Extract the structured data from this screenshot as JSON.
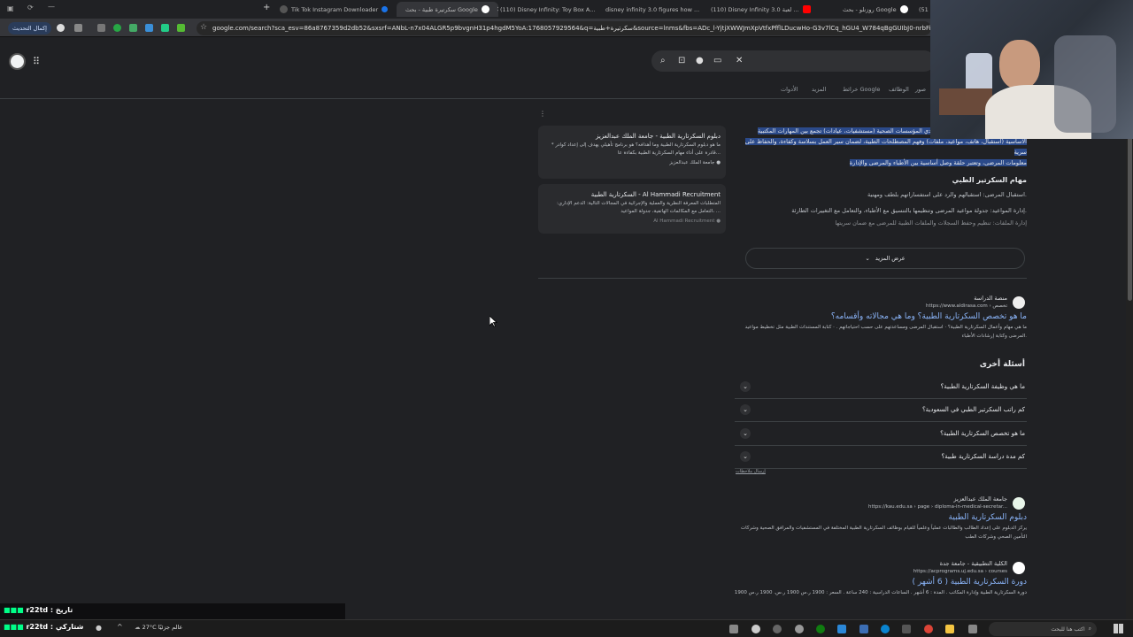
{
  "tabs": [
    {
      "label": "Tik Tok Instagram Downloader",
      "active": false
    },
    {
      "label": "سكرتيرة طبية - بحث Google",
      "active": true
    },
    {
      "label": "(110) Disney Infinity: Toy Box A...",
      "active": false
    },
    {
      "label": "disney infinity 3.0 figures how ...",
      "active": false
    },
    {
      "label": "(110) Disney Infinity 3.0 لعبة ...",
      "active": false
    },
    {
      "label": "روزنلو - بحث Google",
      "active": false
    },
    {
      "label": "(51",
      "active": false
    }
  ],
  "toolbar": {
    "update_label": "إكمال التحديث",
    "url": "google.com/search?sca_esv=86a8767359d2db52&sxsrf=ANbL-n7x04ALGR5p9bvgnH31p4hgdM5YoA:1768057929564&q=سكرتيرة+طبية&source=lnms&fbs=ADc_l-YjtjXWWJmXpVtfxPfflLDucwHo-G3v7lCq_hGU4_W784qBgGUIbJ0-nrbFiftFr2FZawZBVDzWBa9yGmk8"
  },
  "search_nav": {
    "tabs": [
      "صور",
      "الوظائف",
      "خرائط Google",
      "المزيد",
      "الأدوات"
    ]
  },
  "snippet": {
    "lead": "دي المؤسسات الصحية (مستشفيات، عيادات) تجمع بين المهارات المكتبية",
    "lines": [
      "الأساسية (استقبال، هاتف، مواعيد، ملفات) وفهم المصطلحات الطبية، لضمان سير العمل بسلاسة وكفاءة، والحفاظ على سرية",
      "معلومات المرضى، وتعتبر حلقة وصل أساسية بين الأطباء والمرضى والإدارة"
    ],
    "duties_heading": "مهام السكرتير الطبي",
    "duties": [
      "استقبال المرضى: استقبالهم والرد على استفساراتهم بلطف ومهنية.",
      "إدارة المواعيد: جدولة مواعيد المرضى وتنظيمها بالتنسيق مع الأطباء، والتعامل مع التغييرات الطارئة.",
      "إدارة الملفات: تنظيم وحفظ السجلات والملفات الطبية للمرضى مع ضمان سريتها"
    ],
    "show_more": "عرض المزيد"
  },
  "side_cards": [
    {
      "title": "دبلوم السكرتارية الطبية - جامعة الملك عبدالعزيز",
      "body": "* ما هو دبلوم السكرتارية الطبية وما أهدافه؟ هو برنامج تأهيلي يهدف إلى إعداد كوادر قادرة على أداء مهام السكرتارية الطبية بكفاءة عا...",
      "source": "جامعة الملك عبدالعزيز"
    },
    {
      "title": "السكرتارية الطبية - Al Hammadi Recruitment",
      "body": "المتطلبات المعرفة النظرية والعملية والإجرائية في المجالات التالية: الدعم الإداري: التعامل مع المكالمات الهاتفية، جدولة المواعيد، ...",
      "source": "Al Hammadi Recruitment"
    }
  ],
  "result1": {
    "site": "منصة الدراسة",
    "url": "https://www.aldirasa.com › تخصص",
    "title": "ما هو تخصص السكرتارية الطبية؟ وما هي مجالاته وأقسامه؟",
    "desc1": "ما هي مهام وأعمال السكرتارية الطبية؟ · استقبال المرضى ومساعدتهم على حسب احتياجاتهم . · كتابة المستندات الطبية مثل تخطيط مواعيد",
    "desc2": "المرضى وكتابة إرشادات الأطباء."
  },
  "paa": {
    "heading": "أسئلة أخرى",
    "questions": [
      "ما هي وظيفة السكرتارية الطبية؟",
      "كم راتب السكرتير الطبي في السعودية؟",
      "ما هو تخصص السكرتارية الطبية؟",
      "كم مدة دراسة السكرتارية طبية؟"
    ],
    "feedback": "إرسال ملاحظات"
  },
  "result2": {
    "site": "جامعة الملك عبدالعزيز",
    "url": "https://kau.edu.sa › page › diploma-in-medical-secretar...",
    "title": "دبلوم السكرتارية الطبية",
    "desc1": "يركز الدبلوم على إعداد الطالب والطالبات عملياً وعلمياً للقيام بوظائف السكرتارية الطبية المختلفة في المستشفيات والمرافق الصحية وشركات",
    "desc2": "التأمين الصحي وشركات الطب"
  },
  "result3": {
    "site": "الكلية التطبيقية - جامعة جدة",
    "url": "https://acprograms.uj.edu.sa › courses",
    "title": "دورة السكرتارية الطبية ( 6 أشهر )",
    "desc1": "دورة السكرتارية الطبية وإدارة المكاتب . المدة : 6 أشهر . الساعات الدراسية : 240 ساعة . السعر : 1900 ر.س 1900 ر.س. 1900 ر.س 1900"
  },
  "overlay": {
    "line1": "r22td : تاريخ",
    "line2": "r22td : شتاركي"
  },
  "taskbar": {
    "weather": "27°C  عالم جزئيًا",
    "search_placeholder": "اكتب هنا للبحث"
  },
  "colors": {
    "page_bg": "#202124",
    "link": "#8ab4f8",
    "highlight": "#2b4a8a"
  }
}
